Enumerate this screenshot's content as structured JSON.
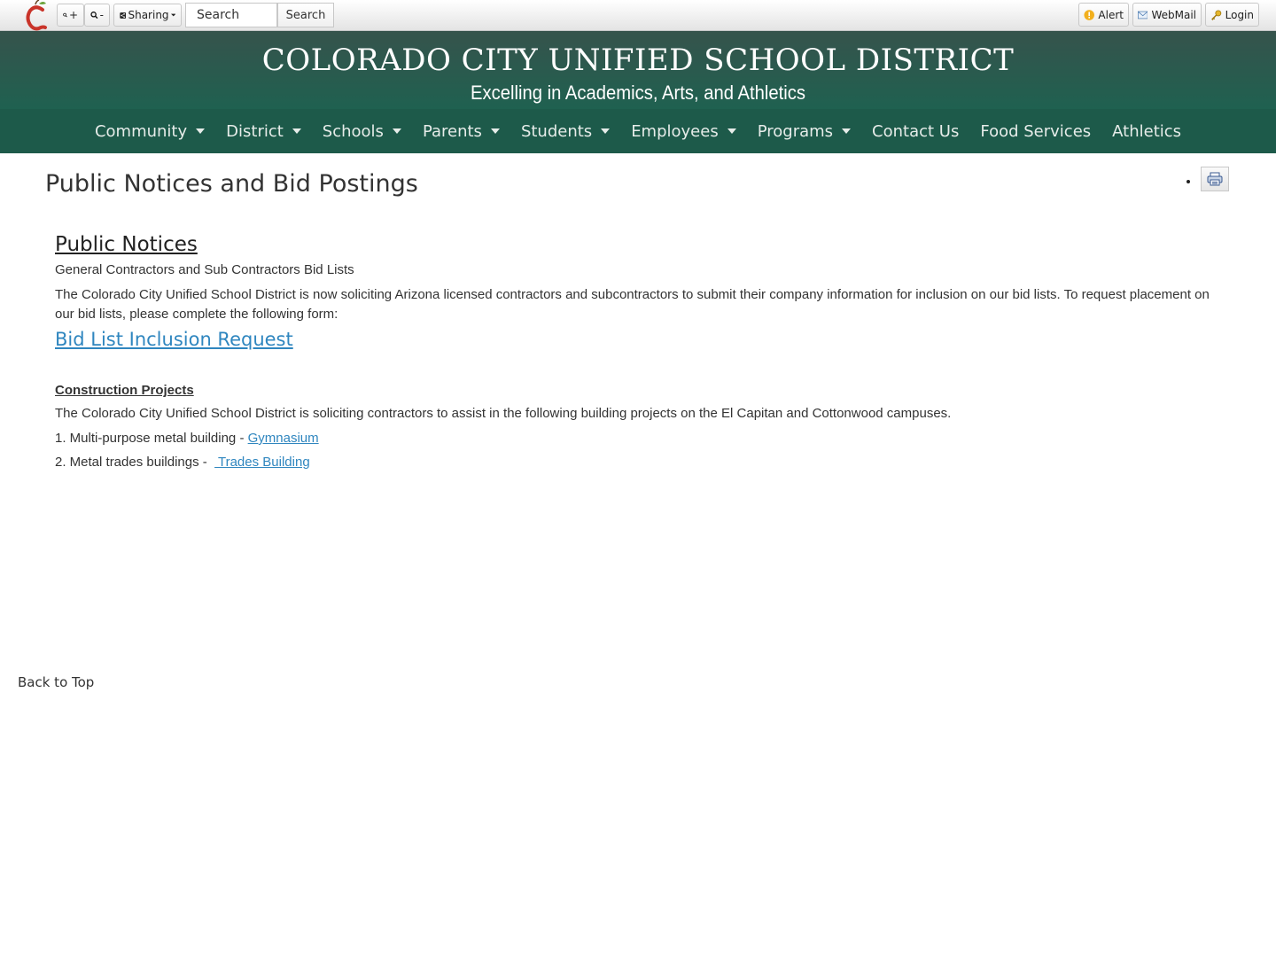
{
  "toolbar": {
    "zoom_in_label": "+",
    "zoom_out_label": "-",
    "sharing_label": "Sharing",
    "search_placeholder": "Search",
    "search_button": "Search",
    "alert_label": "Alert",
    "webmail_label": "WebMail",
    "login_label": "Login"
  },
  "banner": {
    "title": "COLORADO CITY UNIFIED SCHOOL DISTRICT",
    "subtitle": "Excelling in Academics, Arts, and Athletics"
  },
  "nav": {
    "items": [
      {
        "label": "Community"
      },
      {
        "label": "District"
      },
      {
        "label": "Schools"
      },
      {
        "label": "Parents"
      },
      {
        "label": "Students"
      },
      {
        "label": "Employees"
      },
      {
        "label": "Programs"
      },
      {
        "label": "Contact Us"
      },
      {
        "label": "Food Services"
      },
      {
        "label": "Athletics"
      }
    ]
  },
  "page": {
    "title": "Public Notices and Bid Postings",
    "section_heading": "Public Notices",
    "bid_lists_heading": "General Contractors and Sub Contractors Bid Lists",
    "bid_lists_text": "The Colorado City Unified School District is now soliciting Arizona licensed contractors and subcontractors to submit their company information for inclusion on our bid lists.  To request placement on our bid lists, please complete the following form:",
    "bid_link": "Bid List Inclusion Request",
    "construction_heading": "Construction Projects",
    "construction_text": "The Colorado City Unified School District is soliciting contractors to assist in the following building projects on the El Capitan and Cottonwood campuses.",
    "project1_prefix": "1. Multi-purpose metal building - ",
    "project1_link": "Gymnasium",
    "project2_prefix": "2. Metal trades buildings -  ",
    "project2_link": " Trades Building",
    "back_to_top": "Back to Top"
  }
}
